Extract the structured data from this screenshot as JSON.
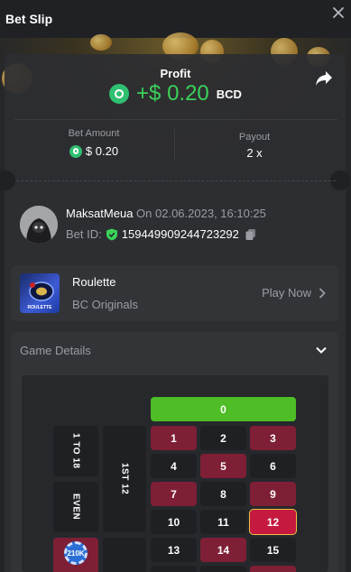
{
  "header": {
    "title": "Bet Slip"
  },
  "profit": {
    "label": "Profit",
    "value": "+$ 0.20",
    "currency": "BCD"
  },
  "bet_amount": {
    "label": "Bet Amount",
    "value": "$ 0.20"
  },
  "payout": {
    "label": "Payout",
    "value": "2 x"
  },
  "user": {
    "name": "MaksatMeua",
    "on_text": "On 02.06.2023, 16:10:25",
    "bet_id_label": "Bet ID:",
    "bet_id": "159449909244723292"
  },
  "game": {
    "name": "Roulette",
    "provider": "BC Originals",
    "play_label": "Play Now",
    "thumb_text": "ROULETTE"
  },
  "details": {
    "title": "Game Details"
  },
  "roulette": {
    "zero": "0",
    "numbers": [
      "1",
      "2",
      "3",
      "4",
      "5",
      "6",
      "7",
      "8",
      "9",
      "10",
      "11",
      "12",
      "13",
      "14",
      "15"
    ],
    "side_labels": {
      "low": "1 TO 18",
      "even": "EVEN",
      "dozen": "1ST 12"
    },
    "chip": "210K",
    "highlighted": "12"
  },
  "colors": {
    "accent_green": "#3bd15a",
    "red": "#7e1f36",
    "black": "#1f2023",
    "zero_green": "#4ebd26"
  }
}
